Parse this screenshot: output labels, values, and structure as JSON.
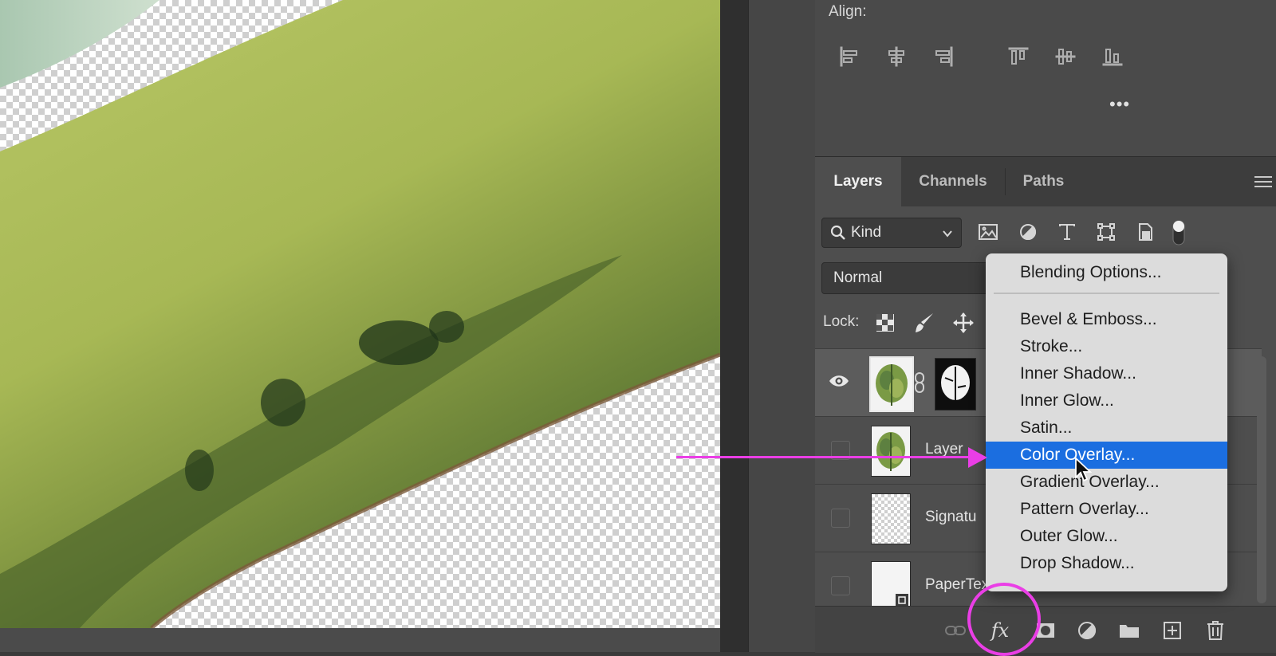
{
  "align_panel": {
    "title": "Align:",
    "icons": [
      "align-left-edges-icon",
      "align-horizontal-centers-icon",
      "align-right-edges-icon",
      "align-top-edges-icon",
      "align-vertical-centers-icon",
      "align-bottom-edges-icon"
    ],
    "more": "•••"
  },
  "layers_panel": {
    "tabs": [
      {
        "label": "Layers",
        "active": true
      },
      {
        "label": "Channels",
        "active": false
      },
      {
        "label": "Paths",
        "active": false
      }
    ],
    "filter": {
      "kind_label": "Kind"
    },
    "blend_mode": "Normal",
    "lock_label": "Lock:",
    "layers": [
      {
        "name": "",
        "visible": true
      },
      {
        "name": "Layer",
        "visible": false
      },
      {
        "name": "Signatu",
        "visible": false
      },
      {
        "name": "PaperTexture",
        "visible": false
      }
    ]
  },
  "fx_menu": {
    "items": [
      "Blending Options...",
      "Bevel & Emboss...",
      "Stroke...",
      "Inner Shadow...",
      "Inner Glow...",
      "Satin...",
      "Color Overlay...",
      "Gradient Overlay...",
      "Pattern Overlay...",
      "Outer Glow...",
      "Drop Shadow..."
    ],
    "selected": "Color Overlay..."
  },
  "bottom_bar": {
    "fx_label": "fx",
    "icons": [
      "link-layers-icon",
      "fx-icon",
      "add-mask-icon",
      "adjustment-layer-icon",
      "new-group-icon",
      "new-layer-icon",
      "delete-layer-icon"
    ]
  },
  "colors": {
    "highlight": "#1b6ee0",
    "annotation": "#ea3ee6"
  }
}
